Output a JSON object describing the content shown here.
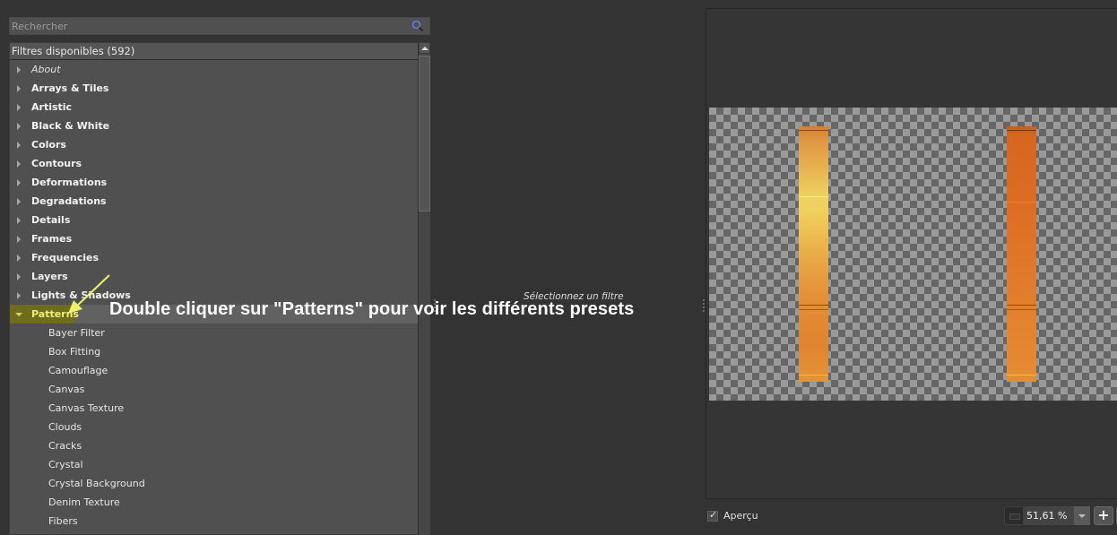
{
  "search": {
    "placeholder": "Rechercher",
    "value": "",
    "icon": "search-icon"
  },
  "tree": {
    "header": "Filtres disponibles (592)",
    "categories": [
      {
        "label": "About",
        "italic": true,
        "expanded": false
      },
      {
        "label": "Arrays & Tiles",
        "expanded": false
      },
      {
        "label": "Artistic",
        "expanded": false
      },
      {
        "label": "Black & White",
        "expanded": false
      },
      {
        "label": "Colors",
        "expanded": false
      },
      {
        "label": "Contours",
        "expanded": false
      },
      {
        "label": "Deformations",
        "expanded": false
      },
      {
        "label": "Degradations",
        "expanded": false
      },
      {
        "label": "Details",
        "expanded": false
      },
      {
        "label": "Frames",
        "expanded": false
      },
      {
        "label": "Frequencies",
        "expanded": false
      },
      {
        "label": "Layers",
        "expanded": false
      },
      {
        "label": "Lights & Shadows",
        "expanded": false
      },
      {
        "label": "Patterns",
        "expanded": true,
        "selected": true
      }
    ],
    "children": [
      "Bayer Filter",
      "Box Fitting",
      "Camouflage",
      "Canvas",
      "Canvas Texture",
      "Clouds",
      "Cracks",
      "Crystal",
      "Crystal Background",
      "Denim Texture",
      "Fibers"
    ],
    "highlight_color": "#6e6d1c",
    "selected_text_color": "#f0ee7a"
  },
  "annotation": {
    "text": "Double cliquer sur \"Patterns\" pour voir les différents presets",
    "arrow_color": "#f2ef6a"
  },
  "middle": {
    "hint": "Sélectionnez un filtre"
  },
  "preview": {
    "bars": [
      {
        "name": "left-bar",
        "colors": [
          "#d0822c",
          "#eed262",
          "#e0842f"
        ]
      },
      {
        "name": "right-bar",
        "colors": [
          "#c6601f",
          "#dc6d22",
          "#e48d33"
        ]
      }
    ]
  },
  "footer": {
    "apercu_label": "Aperçu",
    "apercu_checked": true,
    "zoom_value": "51,61 %",
    "zoom_in_label": "+",
    "zoom_fit_label": "◐"
  }
}
